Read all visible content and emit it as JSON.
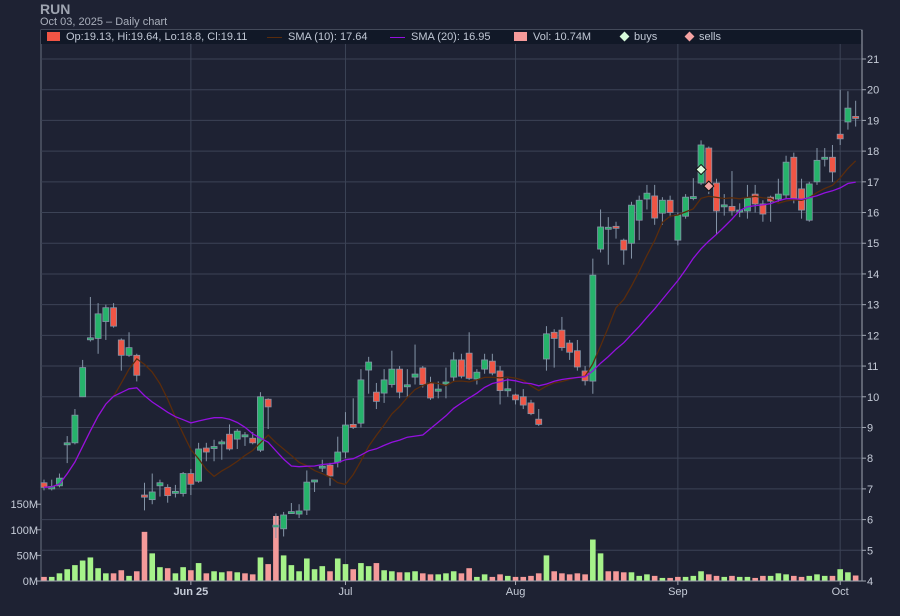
{
  "header": {
    "title": "RUN",
    "subtitle": "Oct 03, 2025 – Daily chart"
  },
  "legend": {
    "ohlc": "Op:19.13, Hi:19.64, Lo:18.8, Cl:19.11",
    "sma10": "SMA (10): 17.64",
    "sma20": "SMA (20): 16.95",
    "vol": "Vol: 10.74M",
    "buys": "buys",
    "sells": "sells"
  },
  "colors": {
    "background": "#1e2233",
    "up": "#26b36b",
    "down": "#f05545",
    "outline": "#8494a7",
    "vol_up": "#a6f28a",
    "vol_down": "#f59a9a",
    "sma10": "#5a2c0c",
    "sma20": "#9410e0",
    "grid": "#3c4356",
    "buy": "#d7fadb",
    "sell": "#f5a3a3"
  },
  "chart_data": {
    "type": "candlestick",
    "title": "RUN",
    "price_axis": {
      "range": [
        4,
        21
      ],
      "ticks": [
        4,
        5,
        6,
        7,
        8,
        9,
        10,
        11,
        12,
        13,
        14,
        15,
        16,
        17,
        18,
        19,
        20,
        21
      ],
      "side": "right"
    },
    "volume_axis": {
      "ticks": [
        0,
        50,
        100,
        150
      ],
      "tick_labels": [
        "0M",
        "50M",
        "100M",
        "150M"
      ],
      "unit": "M",
      "side": "left"
    },
    "x_labels": [
      {
        "label": "Jun 25",
        "index": 19
      },
      {
        "label": "Jul",
        "index": 39
      },
      {
        "label": "Aug",
        "index": 61
      },
      {
        "label": "Sep",
        "index": 82
      },
      {
        "label": "Oct",
        "index": 103
      }
    ],
    "grid": true,
    "legend_position": "top",
    "ohlc": [
      [
        7.2,
        7.3,
        6.95,
        7.05
      ],
      [
        7.0,
        7.3,
        6.95,
        7.08
      ],
      [
        7.1,
        7.5,
        7.05,
        7.35
      ],
      [
        8.45,
        8.72,
        7.84,
        8.5
      ],
      [
        8.5,
        9.6,
        8.45,
        9.4
      ],
      [
        10.0,
        11.2,
        9.99,
        10.95
      ],
      [
        11.88,
        13.25,
        11.8,
        11.92
      ],
      [
        11.9,
        13.05,
        11.4,
        12.7
      ],
      [
        12.45,
        13.0,
        11.85,
        12.9
      ],
      [
        12.9,
        13.05,
        12.25,
        12.3
      ],
      [
        11.85,
        11.9,
        10.85,
        11.35
      ],
      [
        11.35,
        12.1,
        11.3,
        11.6
      ],
      [
        11.35,
        11.4,
        10.5,
        10.7
      ],
      [
        6.8,
        7.2,
        6.3,
        6.73
      ],
      [
        6.65,
        7.5,
        6.5,
        6.9
      ],
      [
        7.1,
        7.3,
        6.75,
        7.2
      ],
      [
        7.05,
        7.15,
        6.55,
        6.78
      ],
      [
        6.88,
        7.13,
        6.72,
        6.92
      ],
      [
        6.85,
        7.55,
        6.75,
        7.5
      ],
      [
        7.5,
        7.65,
        6.8,
        7.15
      ],
      [
        7.25,
        8.5,
        7.2,
        8.3
      ],
      [
        8.33,
        8.5,
        7.9,
        8.2
      ],
      [
        8.33,
        8.6,
        7.9,
        8.38
      ],
      [
        8.5,
        8.6,
        7.95,
        8.53
      ],
      [
        8.78,
        9.1,
        8.25,
        8.3
      ],
      [
        8.62,
        8.95,
        8.3,
        8.88
      ],
      [
        8.73,
        8.85,
        8.4,
        8.76
      ],
      [
        8.65,
        8.85,
        8.45,
        8.5
      ],
      [
        8.26,
        10.15,
        8.2,
        10.0
      ],
      [
        9.92,
        9.95,
        8.95,
        9.67
      ],
      [
        5.8,
        6.2,
        5.4,
        5.82
      ],
      [
        5.7,
        6.25,
        5.45,
        6.15
      ],
      [
        6.24,
        6.54,
        6.2,
        6.26
      ],
      [
        6.18,
        6.5,
        6.05,
        6.28
      ],
      [
        6.31,
        7.6,
        6.15,
        7.22
      ],
      [
        7.26,
        7.3,
        6.9,
        7.29
      ],
      [
        7.68,
        7.95,
        7.55,
        7.74
      ],
      [
        7.77,
        7.85,
        7.1,
        7.42
      ],
      [
        7.87,
        8.7,
        7.7,
        8.2
      ],
      [
        8.2,
        9.5,
        8.0,
        9.08
      ],
      [
        9.1,
        9.95,
        8.95,
        9.0
      ],
      [
        9.14,
        10.9,
        9.0,
        10.55
      ],
      [
        10.87,
        11.3,
        10.1,
        11.13
      ],
      [
        10.15,
        10.45,
        9.6,
        9.85
      ],
      [
        10.12,
        10.9,
        9.8,
        10.55
      ],
      [
        10.4,
        11.5,
        10.3,
        10.9
      ],
      [
        10.9,
        11.0,
        9.95,
        10.15
      ],
      [
        10.37,
        10.9,
        10.0,
        10.39
      ],
      [
        10.64,
        11.7,
        10.4,
        10.74
      ],
      [
        10.94,
        11.0,
        10.3,
        10.4
      ],
      [
        10.44,
        10.65,
        9.9,
        9.96
      ],
      [
        10.18,
        10.5,
        9.95,
        10.25
      ],
      [
        10.42,
        10.95,
        9.95,
        10.48
      ],
      [
        10.64,
        11.45,
        10.5,
        11.2
      ],
      [
        11.2,
        11.4,
        10.6,
        10.67
      ],
      [
        11.42,
        12.1,
        10.55,
        10.6
      ],
      [
        10.58,
        10.9,
        10.4,
        10.8
      ],
      [
        10.9,
        11.4,
        10.75,
        11.2
      ],
      [
        11.16,
        11.4,
        10.7,
        10.77
      ],
      [
        10.84,
        11.0,
        9.75,
        10.2
      ],
      [
        10.24,
        10.6,
        10.0,
        10.26
      ],
      [
        10.06,
        10.1,
        9.75,
        9.9
      ],
      [
        10.0,
        10.25,
        9.6,
        9.73
      ],
      [
        9.8,
        9.9,
        9.4,
        9.45
      ],
      [
        9.27,
        9.6,
        9.05,
        9.1
      ],
      [
        11.23,
        12.3,
        10.85,
        12.05
      ],
      [
        12.1,
        12.2,
        10.95,
        11.9
      ],
      [
        12.17,
        12.6,
        11.5,
        11.6
      ],
      [
        11.75,
        11.85,
        11.2,
        11.45
      ],
      [
        11.5,
        11.85,
        10.85,
        10.97
      ],
      [
        10.84,
        11.0,
        10.37,
        10.52
      ],
      [
        10.51,
        14.5,
        10.1,
        13.96
      ],
      [
        14.81,
        16.1,
        14.7,
        15.53
      ],
      [
        15.48,
        15.85,
        14.3,
        15.52
      ],
      [
        15.55,
        15.7,
        15.15,
        15.5
      ],
      [
        15.1,
        15.15,
        14.3,
        14.78
      ],
      [
        15.0,
        16.35,
        14.5,
        16.24
      ],
      [
        15.75,
        16.55,
        15.1,
        16.4
      ],
      [
        16.44,
        16.9,
        16.1,
        16.63
      ],
      [
        16.54,
        16.9,
        15.6,
        15.82
      ],
      [
        15.98,
        16.5,
        15.6,
        16.4
      ],
      [
        16.4,
        16.55,
        15.85,
        16.0
      ],
      [
        15.1,
        16.0,
        14.93,
        15.92
      ],
      [
        15.88,
        16.6,
        15.8,
        16.5
      ],
      [
        16.47,
        17.12,
        16.4,
        16.52
      ],
      [
        16.96,
        18.35,
        16.9,
        18.2
      ],
      [
        18.1,
        18.15,
        16.6,
        16.9
      ],
      [
        16.96,
        17.1,
        15.3,
        16.05
      ],
      [
        16.22,
        16.6,
        15.9,
        16.25
      ],
      [
        16.2,
        17.35,
        15.9,
        16.05
      ],
      [
        16.03,
        16.3,
        15.85,
        16.08
      ],
      [
        16.05,
        16.9,
        15.8,
        16.47
      ],
      [
        16.6,
        16.9,
        16.0,
        16.28
      ],
      [
        16.28,
        16.4,
        15.7,
        15.95
      ],
      [
        16.5,
        16.55,
        15.7,
        16.37
      ],
      [
        16.44,
        17.1,
        16.35,
        16.6
      ],
      [
        16.57,
        17.85,
        16.45,
        17.64
      ],
      [
        17.8,
        17.95,
        16.3,
        16.47
      ],
      [
        16.77,
        17.1,
        15.8,
        16.08
      ],
      [
        15.75,
        17.0,
        15.7,
        16.93
      ],
      [
        17.0,
        18.1,
        16.9,
        17.7
      ],
      [
        17.78,
        18.1,
        17.5,
        17.8
      ],
      [
        17.8,
        18.2,
        17.0,
        17.32
      ],
      [
        18.55,
        20.0,
        18.2,
        18.4
      ],
      [
        18.95,
        19.95,
        18.7,
        19.4
      ],
      [
        19.13,
        19.64,
        18.8,
        19.11
      ]
    ],
    "volume_m": [
      8,
      8,
      15,
      23,
      31,
      40,
      46,
      25,
      15,
      15,
      21,
      10,
      19,
      96,
      54,
      27,
      25,
      15,
      27,
      21,
      35,
      15,
      19,
      17,
      19,
      17,
      15,
      13,
      46,
      33,
      127,
      50,
      31,
      19,
      44,
      23,
      29,
      19,
      44,
      33,
      23,
      35,
      29,
      35,
      21,
      19,
      17,
      17,
      19,
      15,
      13,
      13,
      15,
      19,
      15,
      25,
      8,
      13,
      8,
      13,
      10,
      8,
      8,
      10,
      15,
      50,
      19,
      15,
      13,
      15,
      13,
      81,
      54,
      19,
      19,
      17,
      17,
      10,
      13,
      10,
      6,
      6,
      8,
      8,
      10,
      19,
      13,
      10,
      8,
      10,
      8,
      8,
      6,
      10,
      10,
      15,
      13,
      10,
      8,
      10,
      13,
      10,
      10,
      23,
      17,
      10.74
    ],
    "sma_periods": [
      10,
      20
    ],
    "markers": [
      {
        "type": "buy",
        "index": 85,
        "price": 17.4
      },
      {
        "type": "sell",
        "index": 86,
        "price": 16.86
      }
    ]
  }
}
